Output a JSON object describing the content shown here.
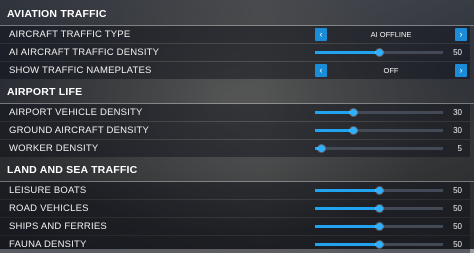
{
  "sections": [
    {
      "title": "AVIATION TRAFFIC",
      "rows": [
        {
          "label": "AIRCRAFT TRAFFIC TYPE",
          "type": "selector",
          "value": "AI OFFLINE"
        },
        {
          "label": "AI AIRCRAFT TRAFFIC DENSITY",
          "type": "slider",
          "value": "50",
          "level": 0.5
        },
        {
          "label": "SHOW TRAFFIC NAMEPLATES",
          "type": "selector",
          "value": "OFF"
        }
      ]
    },
    {
      "title": "AIRPORT LIFE",
      "rows": [
        {
          "label": "AIRPORT VEHICLE DENSITY",
          "type": "slider",
          "value": "30",
          "level": 0.3
        },
        {
          "label": "GROUND AIRCRAFT DENSITY",
          "type": "slider",
          "value": "30",
          "level": 0.3
        },
        {
          "label": "WORKER DENSITY",
          "type": "slider",
          "value": "5",
          "level": 0.05
        }
      ]
    },
    {
      "title": "LAND AND SEA TRAFFIC",
      "rows": [
        {
          "label": "LEISURE BOATS",
          "type": "slider",
          "value": "50",
          "level": 0.5
        },
        {
          "label": "ROAD VEHICLES",
          "type": "slider",
          "value": "50",
          "level": 0.5
        },
        {
          "label": "SHIPS AND FERRIES",
          "type": "slider",
          "value": "50",
          "level": 0.5
        },
        {
          "label": "FAUNA DENSITY",
          "type": "slider",
          "value": "50",
          "level": 0.5
        }
      ]
    }
  ],
  "icons": {
    "left_arrow": "chevron-left-icon",
    "right_arrow": "chevron-right-icon"
  },
  "colors": {
    "accent": "#1a8cd8",
    "slider_fill": "#22a3f0",
    "text": "#f2f2f2"
  }
}
